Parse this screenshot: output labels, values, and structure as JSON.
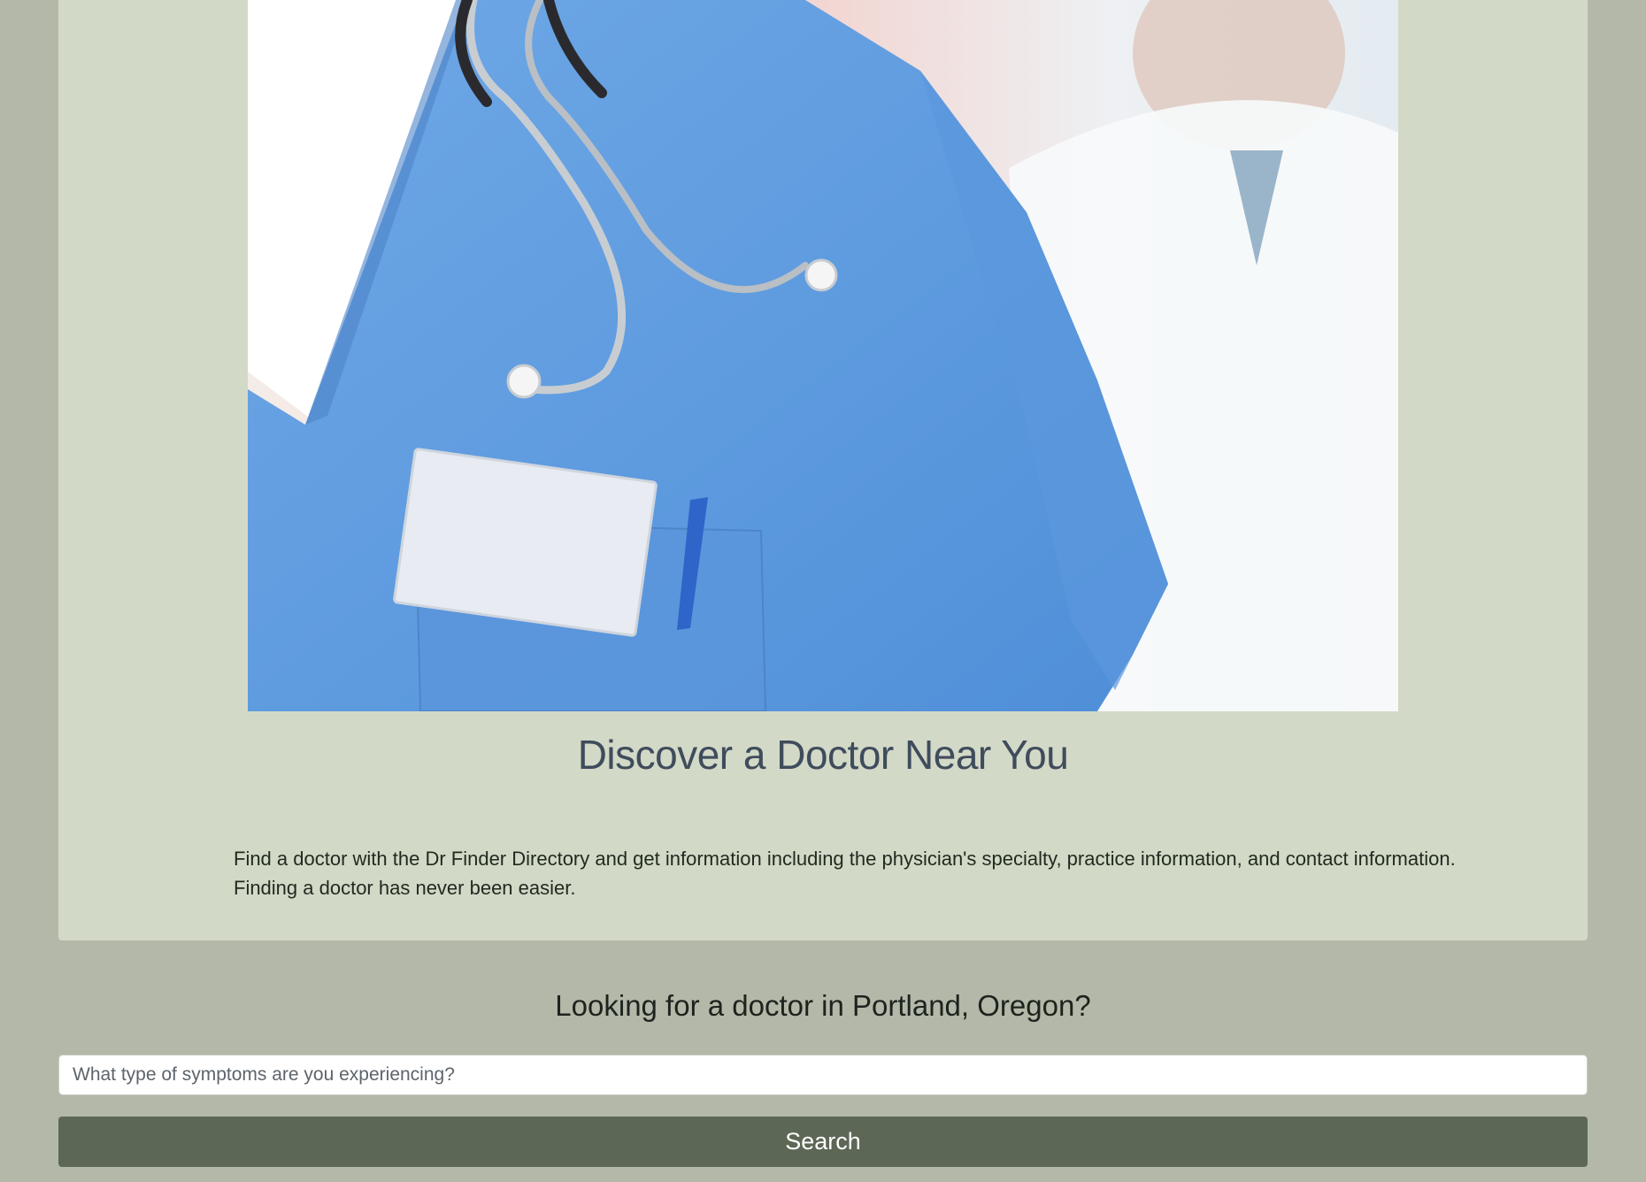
{
  "hero": {
    "image_alt": "Doctor in blue scrubs with stethoscope",
    "title": "Discover a Doctor Near You",
    "lead": "Find a doctor with the Dr Finder Directory and get information including the physician's specialty, practice information, and contact information. Finding a doctor has never been easier."
  },
  "search": {
    "question": "Looking for a doctor in Portland, Oregon?",
    "placeholder": "What type of symptoms are you experiencing?",
    "value": "",
    "button_label": "Search"
  },
  "colors": {
    "page_background": "#b3b8a8",
    "jumbotron_background": "#d3d9c7",
    "title_color": "#3f4c5c",
    "button_background": "#5d6756"
  }
}
